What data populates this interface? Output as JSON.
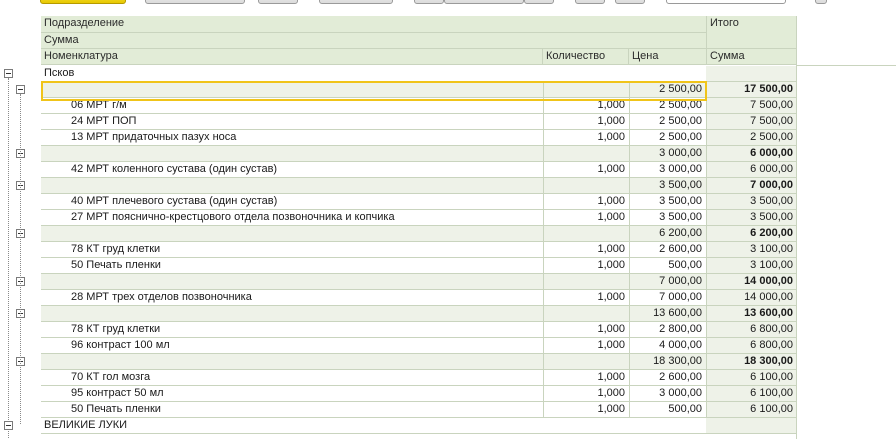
{
  "header": {
    "subdivision": "Подразделение",
    "sum_top": "Сумма",
    "nomenclature": "Номенклатура",
    "quantity": "Количество",
    "price": "Цена",
    "total": "Итого",
    "total_sum": "Сумма"
  },
  "rows": [
    {
      "type": "root",
      "name": "Псков",
      "qty": "",
      "price": "",
      "total": ""
    },
    {
      "type": "group",
      "name": "",
      "qty": "",
      "price": "2 500,00",
      "total": "17 500,00"
    },
    {
      "type": "item",
      "name": "06 МРТ г/м",
      "qty": "1,000",
      "price": "2 500,00",
      "total": "7 500,00"
    },
    {
      "type": "item",
      "name": "24 МРТ ПОП",
      "qty": "1,000",
      "price": "2 500,00",
      "total": "7 500,00"
    },
    {
      "type": "item",
      "name": "13 МРТ придаточных пазух носа",
      "qty": "1,000",
      "price": "2 500,00",
      "total": "2 500,00"
    },
    {
      "type": "group",
      "name": "",
      "qty": "",
      "price": "3 000,00",
      "total": "6 000,00"
    },
    {
      "type": "item",
      "name": "42 МРТ коленного сустава (один сустав)",
      "qty": "1,000",
      "price": "3 000,00",
      "total": "6 000,00"
    },
    {
      "type": "group",
      "name": "",
      "qty": "",
      "price": "3 500,00",
      "total": "7 000,00"
    },
    {
      "type": "item",
      "name": "40 МРТ плечевого сустава (один сустав)",
      "qty": "1,000",
      "price": "3 500,00",
      "total": "3 500,00"
    },
    {
      "type": "item",
      "name": "27 МРТ пояснично-крестцового отдела позвоночника и копчика",
      "qty": "1,000",
      "price": "3 500,00",
      "total": "3 500,00"
    },
    {
      "type": "group",
      "name": "",
      "qty": "",
      "price": "6 200,00",
      "total": "6 200,00"
    },
    {
      "type": "item",
      "name": "78 КТ груд клетки",
      "qty": "1,000",
      "price": "2 600,00",
      "total": "3 100,00"
    },
    {
      "type": "item",
      "name": "50 Печать пленки",
      "qty": "1,000",
      "price": "500,00",
      "total": "3 100,00"
    },
    {
      "type": "group",
      "name": "",
      "qty": "",
      "price": "7 000,00",
      "total": "14 000,00"
    },
    {
      "type": "item",
      "name": "28 МРТ трех отделов позвоночника",
      "qty": "1,000",
      "price": "7 000,00",
      "total": "14 000,00"
    },
    {
      "type": "group",
      "name": "",
      "qty": "",
      "price": "13 600,00",
      "total": "13 600,00"
    },
    {
      "type": "item",
      "name": "78 КТ груд клетки",
      "qty": "1,000",
      "price": "2 800,00",
      "total": "6 800,00"
    },
    {
      "type": "item",
      "name": "96 контраст 100 мл",
      "qty": "1,000",
      "price": "4 000,00",
      "total": "6 800,00"
    },
    {
      "type": "group",
      "name": "",
      "qty": "",
      "price": "18 300,00",
      "total": "18 300,00"
    },
    {
      "type": "item",
      "name": "70 КТ гол мозга",
      "qty": "1,000",
      "price": "2 600,00",
      "total": "6 100,00"
    },
    {
      "type": "item",
      "name": "95 контраст 50 мл",
      "qty": "1,000",
      "price": "3 000,00",
      "total": "6 100,00"
    },
    {
      "type": "item",
      "name": "50 Печать пленки",
      "qty": "1,000",
      "price": "500,00",
      "total": "6 100,00"
    },
    {
      "type": "root",
      "name": "ВЕЛИКИЕ ЛУКИ",
      "qty": "",
      "price": "",
      "total": ""
    }
  ],
  "colors": {
    "header_bg": "#e2ecd7",
    "group_bg": "#eef2e8",
    "selection": "#f0c419",
    "grid_line": "#c9d4be"
  }
}
